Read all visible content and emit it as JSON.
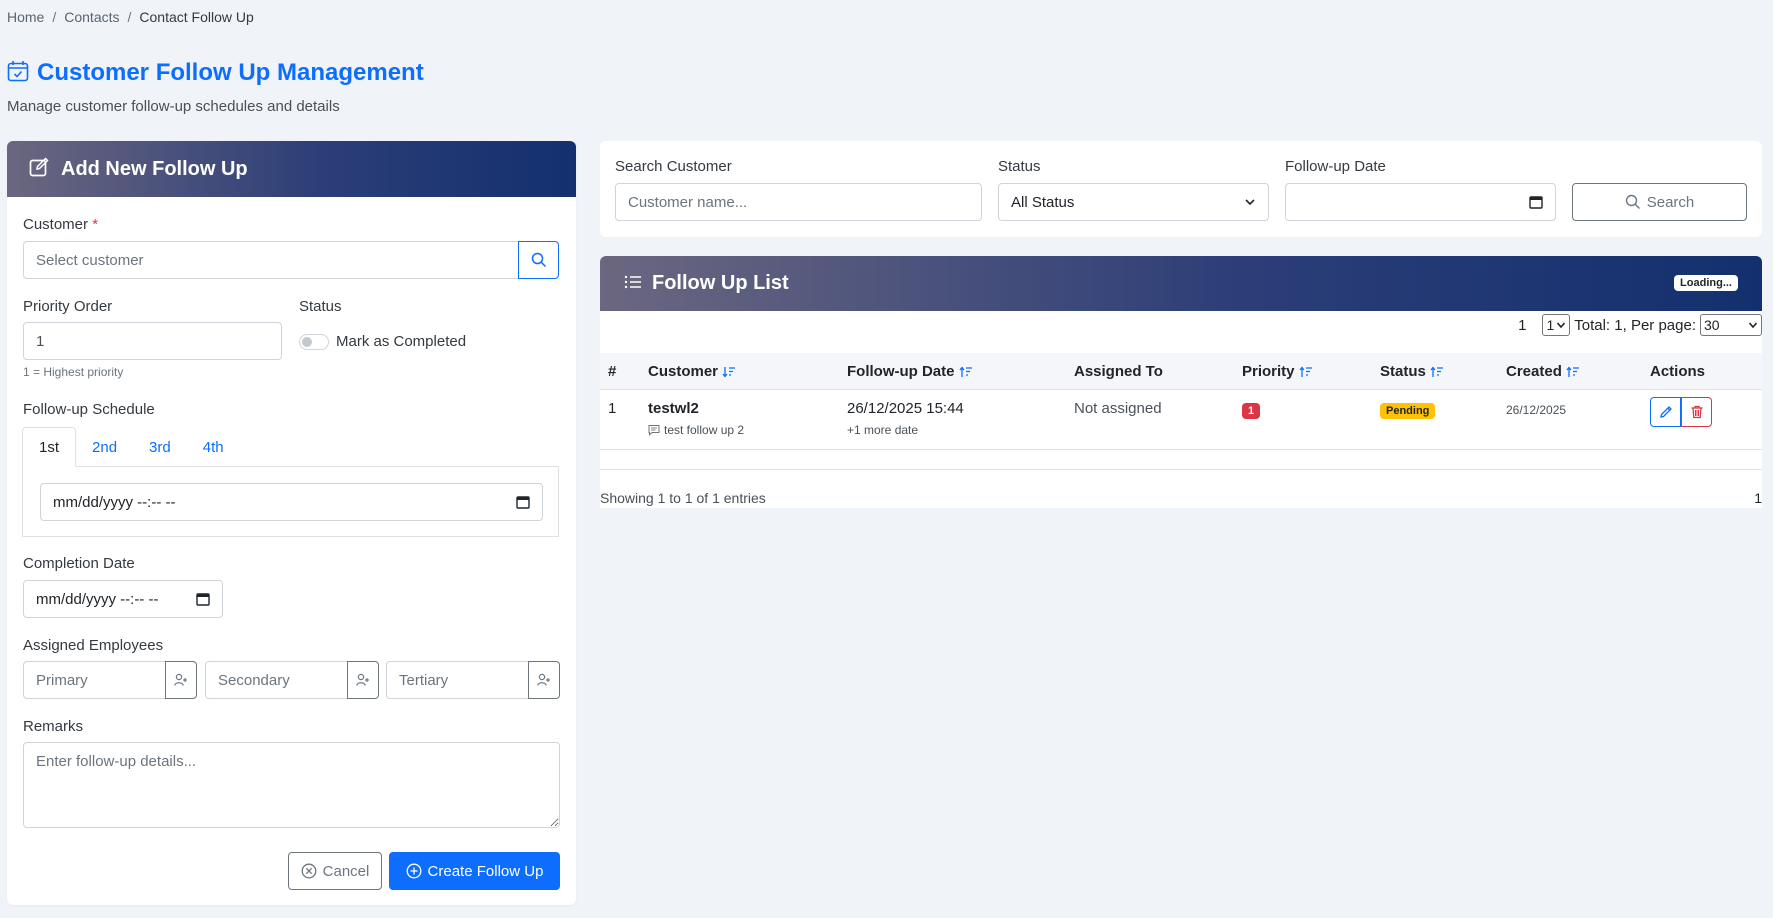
{
  "breadcrumb": {
    "home": "Home",
    "contacts": "Contacts",
    "current": "Contact Follow Up"
  },
  "page": {
    "title": "Customer Follow Up Management",
    "subtitle": "Manage customer follow-up schedules and details"
  },
  "form": {
    "header": "Add New Follow Up",
    "customer_label": "Customer",
    "required_mark": "*",
    "customer_placeholder": "Select customer",
    "priority_label": "Priority Order",
    "priority_value": "1",
    "priority_help": "1 = Highest priority",
    "status_label": "Status",
    "completed_label": "Mark as Completed",
    "schedule_label": "Follow-up Schedule",
    "tabs": [
      "1st",
      "2nd",
      "3rd",
      "4th"
    ],
    "schedule_value": "mm/dd/yyyy --:-- --",
    "completion_label": "Completion Date",
    "completion_value": "mm/dd/yyyy --:-- --",
    "assigned_label": "Assigned Employees",
    "primary_placeholder": "Primary",
    "secondary_placeholder": "Secondary",
    "tertiary_placeholder": "Tertiary",
    "remarks_label": "Remarks",
    "remarks_placeholder": "Enter follow-up details...",
    "cancel_label": "Cancel",
    "create_label": "Create Follow Up"
  },
  "filters": {
    "search_label": "Search Customer",
    "search_placeholder": "Customer name...",
    "status_label": "Status",
    "status_value": "All Status",
    "date_label": "Follow-up Date",
    "search_button": "Search"
  },
  "list": {
    "header": "Follow Up List",
    "loading": "Loading...",
    "page_number": "1",
    "page_select": "1",
    "total_text": "Total: 1, Per page:",
    "per_page": "30",
    "columns": [
      "#",
      "Customer",
      "Follow-up Date",
      "Assigned To",
      "Priority",
      "Status",
      "Created",
      "Actions"
    ],
    "rows": [
      {
        "num": "1",
        "customer": "testwl2",
        "note": "test follow up 2",
        "date": "26/12/2025 15:44",
        "more": "+1 more date",
        "assigned": "Not assigned",
        "priority": "1",
        "status": "Pending",
        "created": "26/12/2025"
      }
    ],
    "showing": "Showing 1 to 1 of 1 entries",
    "footer_page": "1"
  },
  "colors": {
    "primary": "#0d6efd",
    "danger": "#dc3545",
    "warning": "#ffc107",
    "header_dark": "#13306e"
  }
}
